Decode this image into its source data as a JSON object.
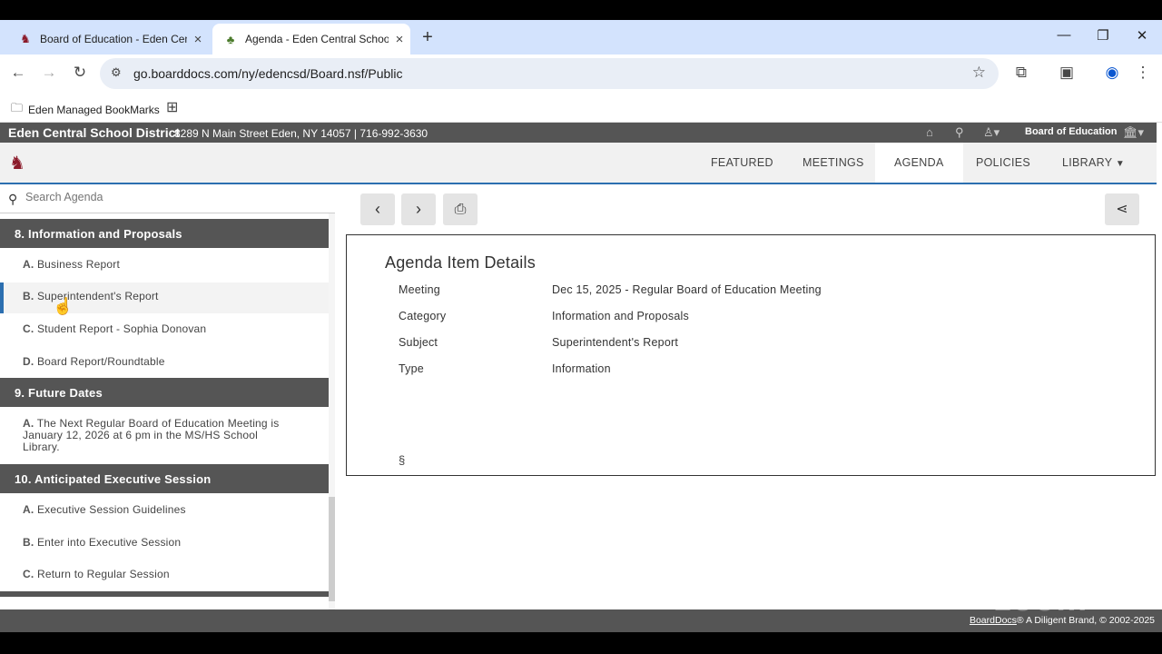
{
  "browser": {
    "tabs": [
      {
        "title": "Board of Education - Eden Cent",
        "favicon": "boarddocs-icon"
      },
      {
        "title": "Agenda - Eden Central School D",
        "favicon": "tree-icon"
      }
    ],
    "url": "go.boarddocs.com/ny/edencsd/Board.nsf/Public",
    "bookmark": "Eden Managed BookMarks"
  },
  "site": {
    "district": "Eden Central School District",
    "address": "8289 N Main Street Eden, NY 14057 | 716-992-3630",
    "board_menu": "Board of Education",
    "nav": [
      "FEATURED",
      "MEETINGS",
      "AGENDA",
      "POLICIES",
      "LIBRARY"
    ]
  },
  "left": {
    "search_placeholder": "Search Agenda",
    "sections": [
      {
        "title": "8. Information and Proposals",
        "items": [
          {
            "letter": "A.",
            "text": "Business Report"
          },
          {
            "letter": "B.",
            "text": "Superintendent's Report"
          },
          {
            "letter": "C.",
            "text": "Student Report - Sophia Donovan"
          },
          {
            "letter": "D.",
            "text": "Board Report/Roundtable"
          }
        ]
      },
      {
        "title": "9. Future Dates",
        "items": [
          {
            "letter": "A.",
            "text": "The Next Regular Board of Education Meeting is January 12, 2026 at 6 pm in the MS/HS School Library."
          }
        ]
      },
      {
        "title": "10. Anticipated Executive Session",
        "items": [
          {
            "letter": "A.",
            "text": "Executive Session Guidelines"
          },
          {
            "letter": "B.",
            "text": "Enter into Executive Session"
          },
          {
            "letter": "C.",
            "text": "Return to Regular Session"
          }
        ]
      }
    ]
  },
  "details": {
    "heading": "Agenda Item Details",
    "rows": [
      {
        "label": "Meeting",
        "value": "Dec 15, 2025 - Regular Board of Education Meeting"
      },
      {
        "label": "Category",
        "value": "Information and Proposals"
      },
      {
        "label": "Subject",
        "value": "Superintendent's Report"
      },
      {
        "label": "Type",
        "value": "Information"
      }
    ],
    "section_mark": "§"
  },
  "footer": {
    "brand": "BoardDocs",
    "text": "® A Diligent Brand, © 2002-2025"
  },
  "watermark": "zoom"
}
